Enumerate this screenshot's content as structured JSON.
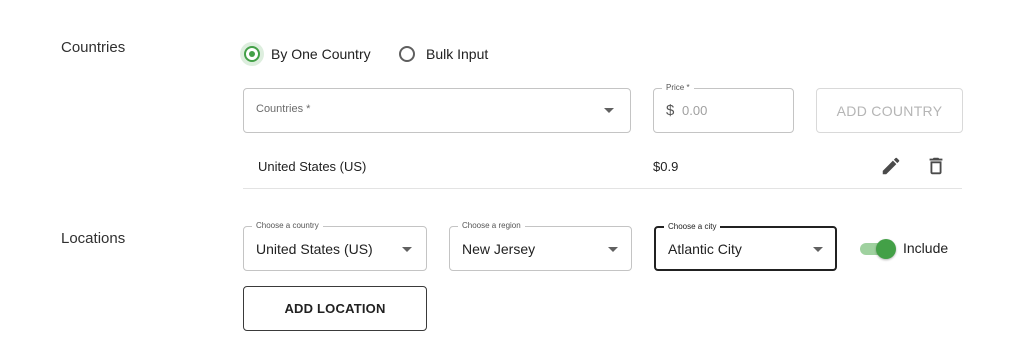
{
  "countries_section": {
    "label": "Countries",
    "radio_options": [
      {
        "label": "By One Country",
        "checked": true
      },
      {
        "label": "Bulk Input",
        "checked": false
      }
    ],
    "country_select": {
      "placeholder": "Countries *"
    },
    "price_field": {
      "label": "Price *",
      "currency_symbol": "$",
      "placeholder": "0.00"
    },
    "add_country_button": "ADD COUNTRY",
    "rows": [
      {
        "country": "United States (US)",
        "price": "$0.9"
      }
    ]
  },
  "locations_section": {
    "label": "Locations",
    "country_select": {
      "label": "Choose a country",
      "value": "United States (US)"
    },
    "region_select": {
      "label": "Choose a region",
      "value": "New Jersey"
    },
    "city_select": {
      "label": "Choose a city",
      "value": "Atlantic City"
    },
    "include_toggle": {
      "label": "Include",
      "on": true
    },
    "add_location_button": "ADD LOCATION"
  },
  "colors": {
    "accent_green": "#43a047",
    "text_primary": "#212121",
    "border": "#c4c4c4"
  },
  "icons": {
    "edit": "pencil-icon",
    "delete": "trash-icon",
    "dropdown": "chevron-down-icon"
  }
}
